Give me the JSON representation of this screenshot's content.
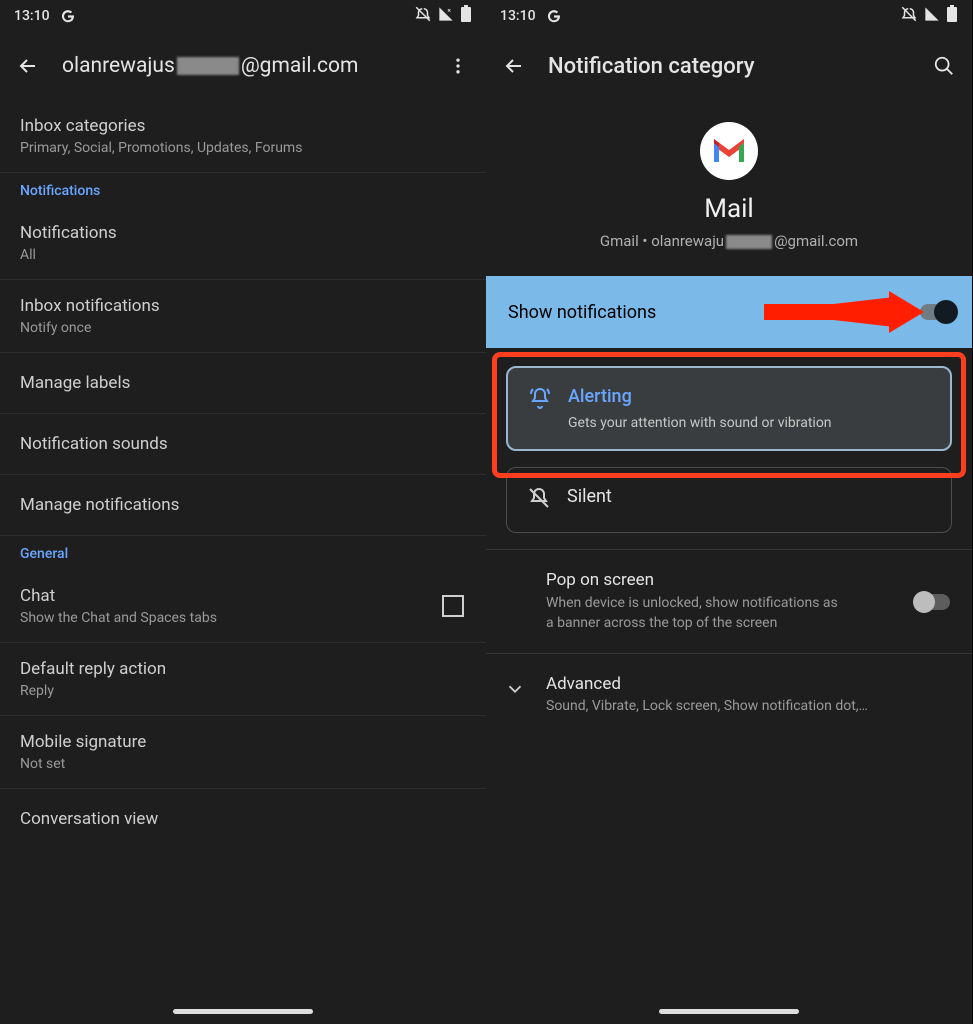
{
  "status": {
    "time": "13:10"
  },
  "left": {
    "title_prefix": "olanrewajus",
    "title_suffix": "@gmail.com",
    "inbox_categories": {
      "title": "Inbox categories",
      "sub": "Primary, Social, Promotions, Updates, Forums"
    },
    "section_notifications": "Notifications",
    "notifications": {
      "title": "Notifications",
      "sub": "All"
    },
    "inbox_notifications": {
      "title": "Inbox notifications",
      "sub": "Notify once"
    },
    "manage_labels": "Manage labels",
    "notification_sounds": "Notification sounds",
    "manage_notifications": "Manage notifications",
    "section_general": "General",
    "chat": {
      "title": "Chat",
      "sub": "Show the Chat and Spaces tabs"
    },
    "default_reply": {
      "title": "Default reply action",
      "sub": "Reply"
    },
    "mobile_signature": {
      "title": "Mobile signature",
      "sub": "Not set"
    },
    "conversation_view": "Conversation view"
  },
  "right": {
    "title": "Notification category",
    "app_name": "Mail",
    "app_sub_prefix": "Gmail • olanrewaju",
    "app_sub_suffix": "@gmail.com",
    "show_notifications": "Show notifications",
    "alerting": {
      "title": "Alerting",
      "desc": "Gets your attention with sound or vibration"
    },
    "silent": "Silent",
    "pop": {
      "title": "Pop on screen",
      "desc": "When device is unlocked, show notifications as a banner across the top of the screen"
    },
    "advanced": {
      "title": "Advanced",
      "desc": "Sound, Vibrate, Lock screen, Show notification dot,…"
    }
  }
}
